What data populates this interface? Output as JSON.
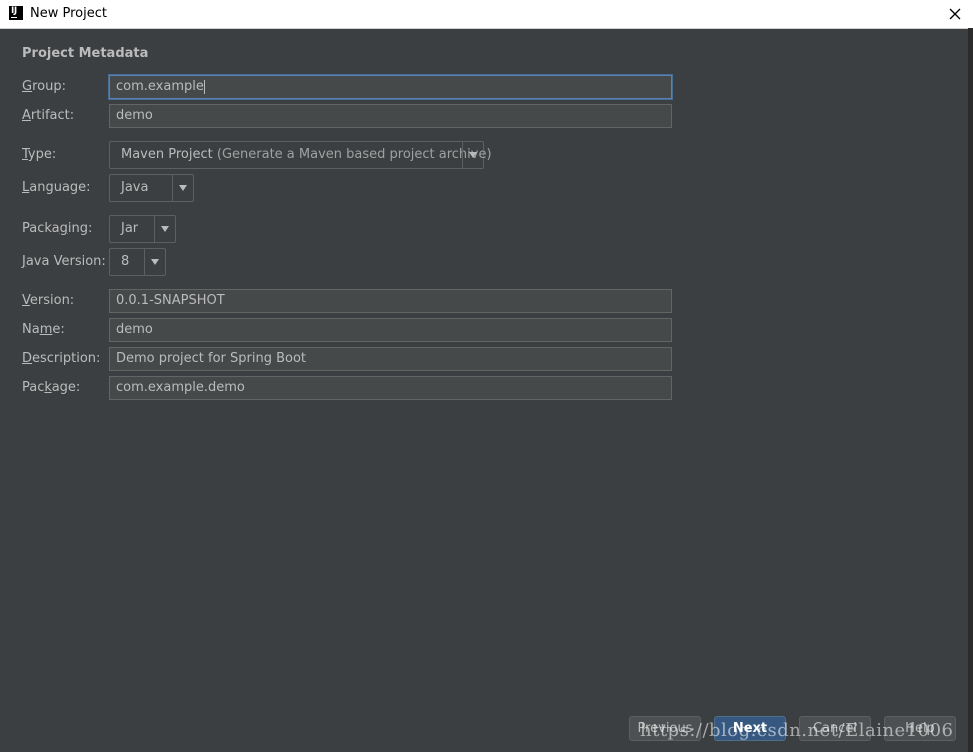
{
  "window": {
    "title": "New Project",
    "app_icon": "intellij-idea-icon"
  },
  "section": {
    "title": "Project Metadata"
  },
  "fields": {
    "group": {
      "label_pre": "",
      "label_mn": "G",
      "label_post": "roup:",
      "value": "com.example"
    },
    "artifact": {
      "label_pre": "",
      "label_mn": "A",
      "label_post": "rtifact:",
      "value": "demo"
    },
    "type": {
      "label_pre": "",
      "label_mn": "T",
      "label_post": "ype:",
      "value": "Maven Project",
      "hint": "(Generate a Maven based project archive)"
    },
    "language": {
      "label_pre": "",
      "label_mn": "L",
      "label_post": "anguage:",
      "value": "Java"
    },
    "packaging": {
      "label_pre": "Packa",
      "label_mn": "g",
      "label_post": "ing:",
      "value": "Jar"
    },
    "java_version": {
      "label_pre": "",
      "label_mn": "J",
      "label_post": "ava Version:",
      "value": "8"
    },
    "version": {
      "label_pre": "",
      "label_mn": "V",
      "label_post": "ersion:",
      "value": "0.0.1-SNAPSHOT"
    },
    "name": {
      "label_pre": "Na",
      "label_mn": "m",
      "label_post": "e:",
      "value": "demo"
    },
    "description": {
      "label_pre": "",
      "label_mn": "D",
      "label_post": "escription:",
      "value": "Demo project for Spring Boot"
    },
    "package": {
      "label_pre": "Pac",
      "label_mn": "k",
      "label_post": "age:",
      "value": "com.example.demo"
    }
  },
  "buttons": {
    "previous": "Previous",
    "next": "Next",
    "cancel": "Cancel",
    "help": "Help"
  },
  "watermark": "https://blog.csdn.net/Elaine1006",
  "colors": {
    "background": "#3c3f41",
    "field_bg": "#45494a",
    "focus_border": "#5a81b7",
    "default_button": "#365880",
    "text": "#bbbbbb"
  }
}
